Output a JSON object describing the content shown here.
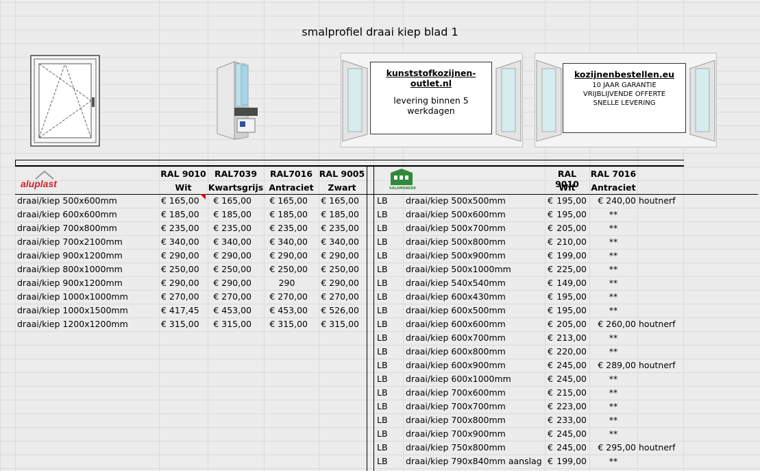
{
  "title": "smalprofiel draai kiep blad 1",
  "banners": [
    {
      "site": "kunststofkozijnen-outlet.nl",
      "lines": [
        "levering binnen 5",
        "werkdagen"
      ]
    },
    {
      "site": "kozijnenbestellen.eu",
      "lines": [
        "10 JAAR GARANTIE",
        "VRIJBLIJVENDE OFFERTE",
        "SNELLE LEVERING"
      ]
    }
  ],
  "left": {
    "brand": "aluplast",
    "columns": [
      {
        "code": "RAL 9010",
        "name": "Wit"
      },
      {
        "code": "RAL7039",
        "name": "Kwartsgrijs"
      },
      {
        "code": "RAL7016",
        "name": "Antraciet"
      },
      {
        "code": "RAL 9005",
        "name": "Zwart"
      }
    ],
    "rows": [
      {
        "item": "draai/kiep 500x600mm",
        "p": [
          "€ 165,00",
          "€ 165,00",
          "€ 165,00",
          "€ 165,00"
        ]
      },
      {
        "item": "draai/kiep 600x600mm",
        "p": [
          "€ 185,00",
          "€ 185,00",
          "€ 185,00",
          "€ 185,00"
        ]
      },
      {
        "item": "draai/kiep 700x800mm",
        "p": [
          "€ 235,00",
          "€ 235,00",
          "€ 235,00",
          "€ 235,00"
        ]
      },
      {
        "item": "draai/kiep 700x2100mm",
        "p": [
          "€ 340,00",
          "€ 340,00",
          "€ 340,00",
          "€ 340,00"
        ]
      },
      {
        "item": "draai/kiep 900x1200mm",
        "p": [
          "€ 290,00",
          "€ 290,00",
          "€ 290,00",
          "€ 290,00"
        ]
      },
      {
        "item": "draai/kiep 800x1000mm",
        "p": [
          "€ 250,00",
          "€ 250,00",
          "€ 250,00",
          "€ 250,00"
        ]
      },
      {
        "item": "draai/kiep 900x1200mm",
        "p": [
          "€ 290,00",
          "€ 290,00",
          "290",
          "€ 290,00"
        ]
      },
      {
        "item": "draai/kiep 1000x1000mm",
        "p": [
          "€ 270,00",
          "€ 270,00",
          "€ 270,00",
          "€ 270,00"
        ]
      },
      {
        "item": "draai/kiep 1000x1500mm",
        "p": [
          "€ 417,45",
          "€ 453,00",
          "€ 453,00",
          "€ 526,00"
        ]
      },
      {
        "item": "draai/kiep 1200x1200mm",
        "p": [
          "€ 315,00",
          "€ 315,00",
          "€ 315,00",
          "€ 315,00"
        ]
      }
    ]
  },
  "right": {
    "brand": "SALAMANDER",
    "columns": [
      {
        "code": "RAL 9010",
        "name": "Wit"
      },
      {
        "code": "RAL 7016",
        "name": "Antraciet"
      }
    ],
    "rows": [
      {
        "t": "LB",
        "item": "draai/kiep 500x500mm",
        "cur": "€",
        "wit": "195,00",
        "ant": "€ 240,00",
        "note": "houtnerf"
      },
      {
        "t": "LB",
        "item": "draai/kiep 500x600mm",
        "cur": "€",
        "wit": "195,00",
        "ant": "**",
        "note": ""
      },
      {
        "t": "LB",
        "item": "draai/kiep 500x700mm",
        "cur": "€",
        "wit": "205,00",
        "ant": "**",
        "note": ""
      },
      {
        "t": "LB",
        "item": "draai/kiep 500x800mm",
        "cur": "€",
        "wit": "210,00",
        "ant": "**",
        "note": ""
      },
      {
        "t": "LB",
        "item": "draai/kiep 500x900mm",
        "cur": "€",
        "wit": "199,00",
        "ant": "**",
        "note": ""
      },
      {
        "t": "LB",
        "item": "draai/kiep 500x1000mm",
        "cur": "€",
        "wit": "225,00",
        "ant": "**",
        "note": ""
      },
      {
        "t": "LB",
        "item": "draai/kiep 540x540mm",
        "cur": "€",
        "wit": "149,00",
        "ant": "**",
        "note": ""
      },
      {
        "t": "LB",
        "item": "draai/kiep 600x430mm",
        "cur": "€",
        "wit": "195,00",
        "ant": "**",
        "note": ""
      },
      {
        "t": "LB",
        "item": "draai/kiep 600x500mm",
        "cur": "€",
        "wit": "195,00",
        "ant": "**",
        "note": ""
      },
      {
        "t": "LB",
        "item": "draai/kiep 600x600mm",
        "cur": "€",
        "wit": "205,00",
        "ant": "€ 260,00",
        "note": "houtnerf"
      },
      {
        "t": "LB",
        "item": "draai/kiep 600x700mm",
        "cur": "€",
        "wit": "213,00",
        "ant": "**",
        "note": ""
      },
      {
        "t": "LB",
        "item": "draai/kiep 600x800mm",
        "cur": "€",
        "wit": "220,00",
        "ant": "**",
        "note": ""
      },
      {
        "t": "LB",
        "item": "draai/kiep 600x900mm",
        "cur": "€",
        "wit": "245,00",
        "ant": "€ 289,00",
        "note": "houtnerf"
      },
      {
        "t": "LB",
        "item": "draai/kiep 600x1000mm",
        "cur": "€",
        "wit": "245,00",
        "ant": "**",
        "note": ""
      },
      {
        "t": "LB",
        "item": "draai/kiep 700x600mm",
        "cur": "€",
        "wit": "215,00",
        "ant": "**",
        "note": ""
      },
      {
        "t": "LB",
        "item": "draai/kiep 700x700mm",
        "cur": "€",
        "wit": "223,00",
        "ant": "**",
        "note": ""
      },
      {
        "t": "LB",
        "item": "draai/kiep 700x800mm",
        "cur": "€",
        "wit": "233,00",
        "ant": "**",
        "note": ""
      },
      {
        "t": "LB",
        "item": "draai/kiep 700x900mm",
        "cur": "€",
        "wit": "245,00",
        "ant": "**",
        "note": ""
      },
      {
        "t": "LB",
        "item": "draai/kiep 750x800mm",
        "cur": "€",
        "wit": "245,00",
        "ant": "€ 295,00",
        "note": "houtnerf"
      },
      {
        "t": "LB",
        "item": "draai/kiep 790x840mm  aanslag",
        "cur": "€",
        "wit": "199,00",
        "ant": "**",
        "note": ""
      }
    ]
  },
  "colors": {
    "brand_red": "#d0202a",
    "salamander_green": "#2f8a3a",
    "grid": "#d9d9d9"
  }
}
